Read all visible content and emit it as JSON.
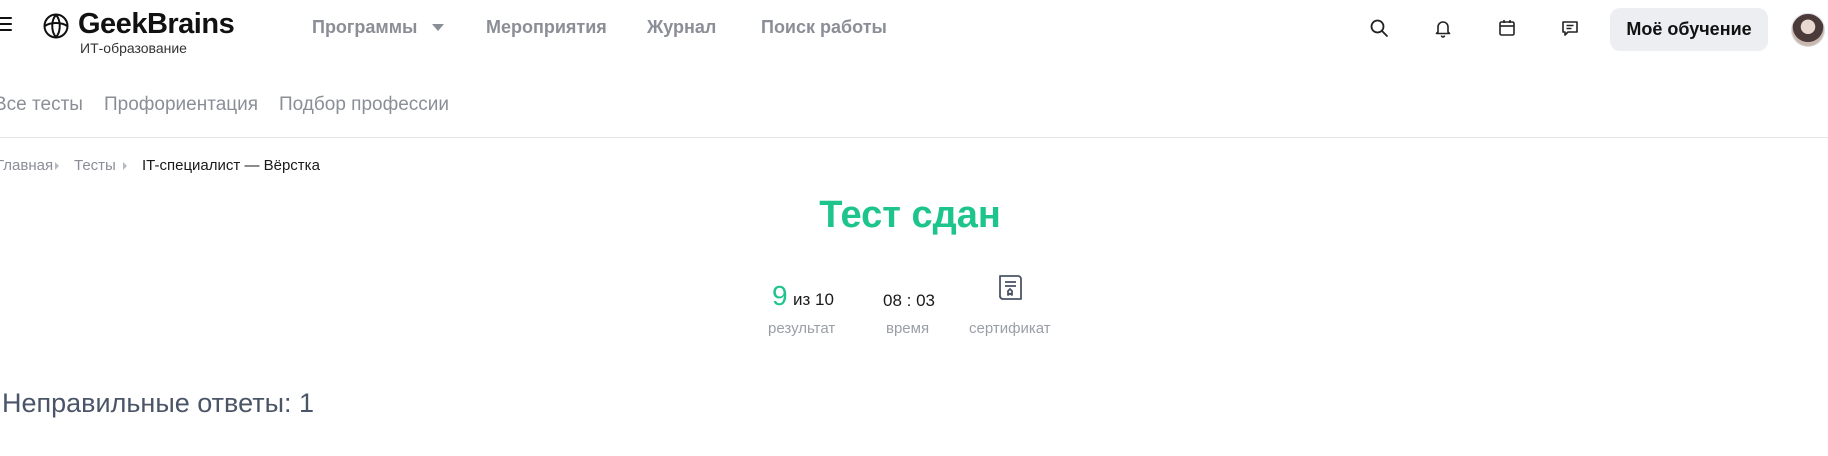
{
  "header": {
    "logo_name": "GeekBrains",
    "logo_sub": "ИТ-образование",
    "nav": [
      "Программы",
      "Мероприятия",
      "Журнал",
      "Поиск работы"
    ],
    "my_learning": "Моё обучение",
    "icons": [
      "menu-icon",
      "search-icon",
      "bell-icon",
      "calendar-icon",
      "chat-icon"
    ]
  },
  "subnav": [
    "Все тесты",
    "Профориентация",
    "Подбор профессии"
  ],
  "breadcrumb": [
    "Главная",
    "Тесты",
    "IT-специалист — Вёрстка"
  ],
  "result": {
    "title": "Тест сдан",
    "score": "9",
    "score_of": "из 10",
    "score_label": "результат",
    "time": "08 : 03",
    "time_label": "время",
    "certificate_label": "сертификат"
  },
  "wrong_answers": "Неправильные ответы: 1",
  "colors": {
    "accent": "#1dc48c",
    "muted": "#8a8e96",
    "button_bg": "#eceef2"
  }
}
